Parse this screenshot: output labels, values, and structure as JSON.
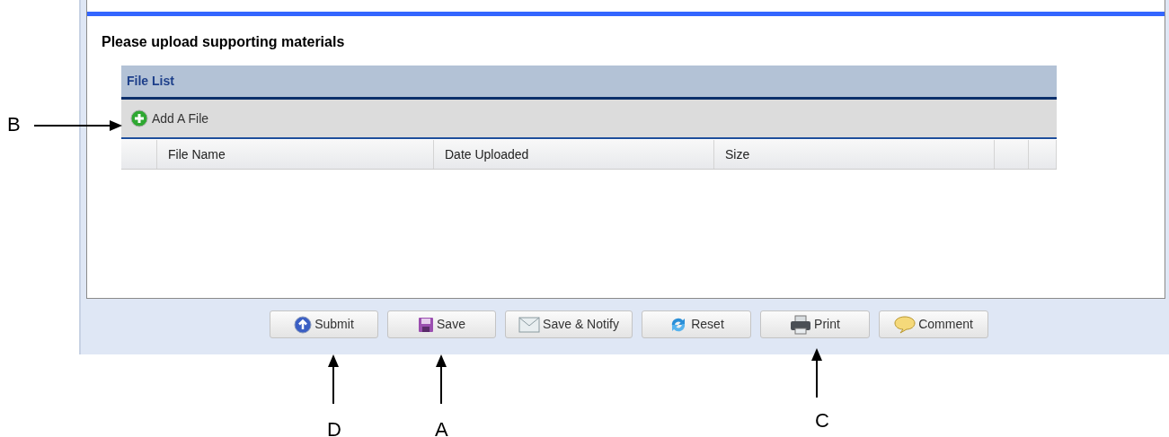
{
  "heading": "Please upload supporting materials",
  "file_list": {
    "title": "File List",
    "add_button": "Add A File",
    "columns": [
      {
        "kind": "blank"
      },
      {
        "kind": "text",
        "label": "File Name"
      },
      {
        "kind": "text",
        "label": "Date Uploaded"
      },
      {
        "kind": "text",
        "label": "Size"
      },
      {
        "kind": "blank"
      },
      {
        "kind": "blank"
      }
    ]
  },
  "buttons": [
    {
      "label": "Submit",
      "kind": "submit"
    },
    {
      "label": "Save",
      "kind": "save"
    },
    {
      "label": "Save & Notify",
      "kind": "mail"
    },
    {
      "label": "Reset",
      "kind": "reset"
    },
    {
      "label": "Print",
      "kind": "print"
    },
    {
      "label": "Comment",
      "kind": "comment"
    }
  ],
  "callouts": [
    {
      "label": "B",
      "kind": "right"
    },
    {
      "label": "D",
      "kind": "up"
    },
    {
      "label": "A",
      "kind": "up"
    },
    {
      "label": "C",
      "kind": "up"
    }
  ]
}
